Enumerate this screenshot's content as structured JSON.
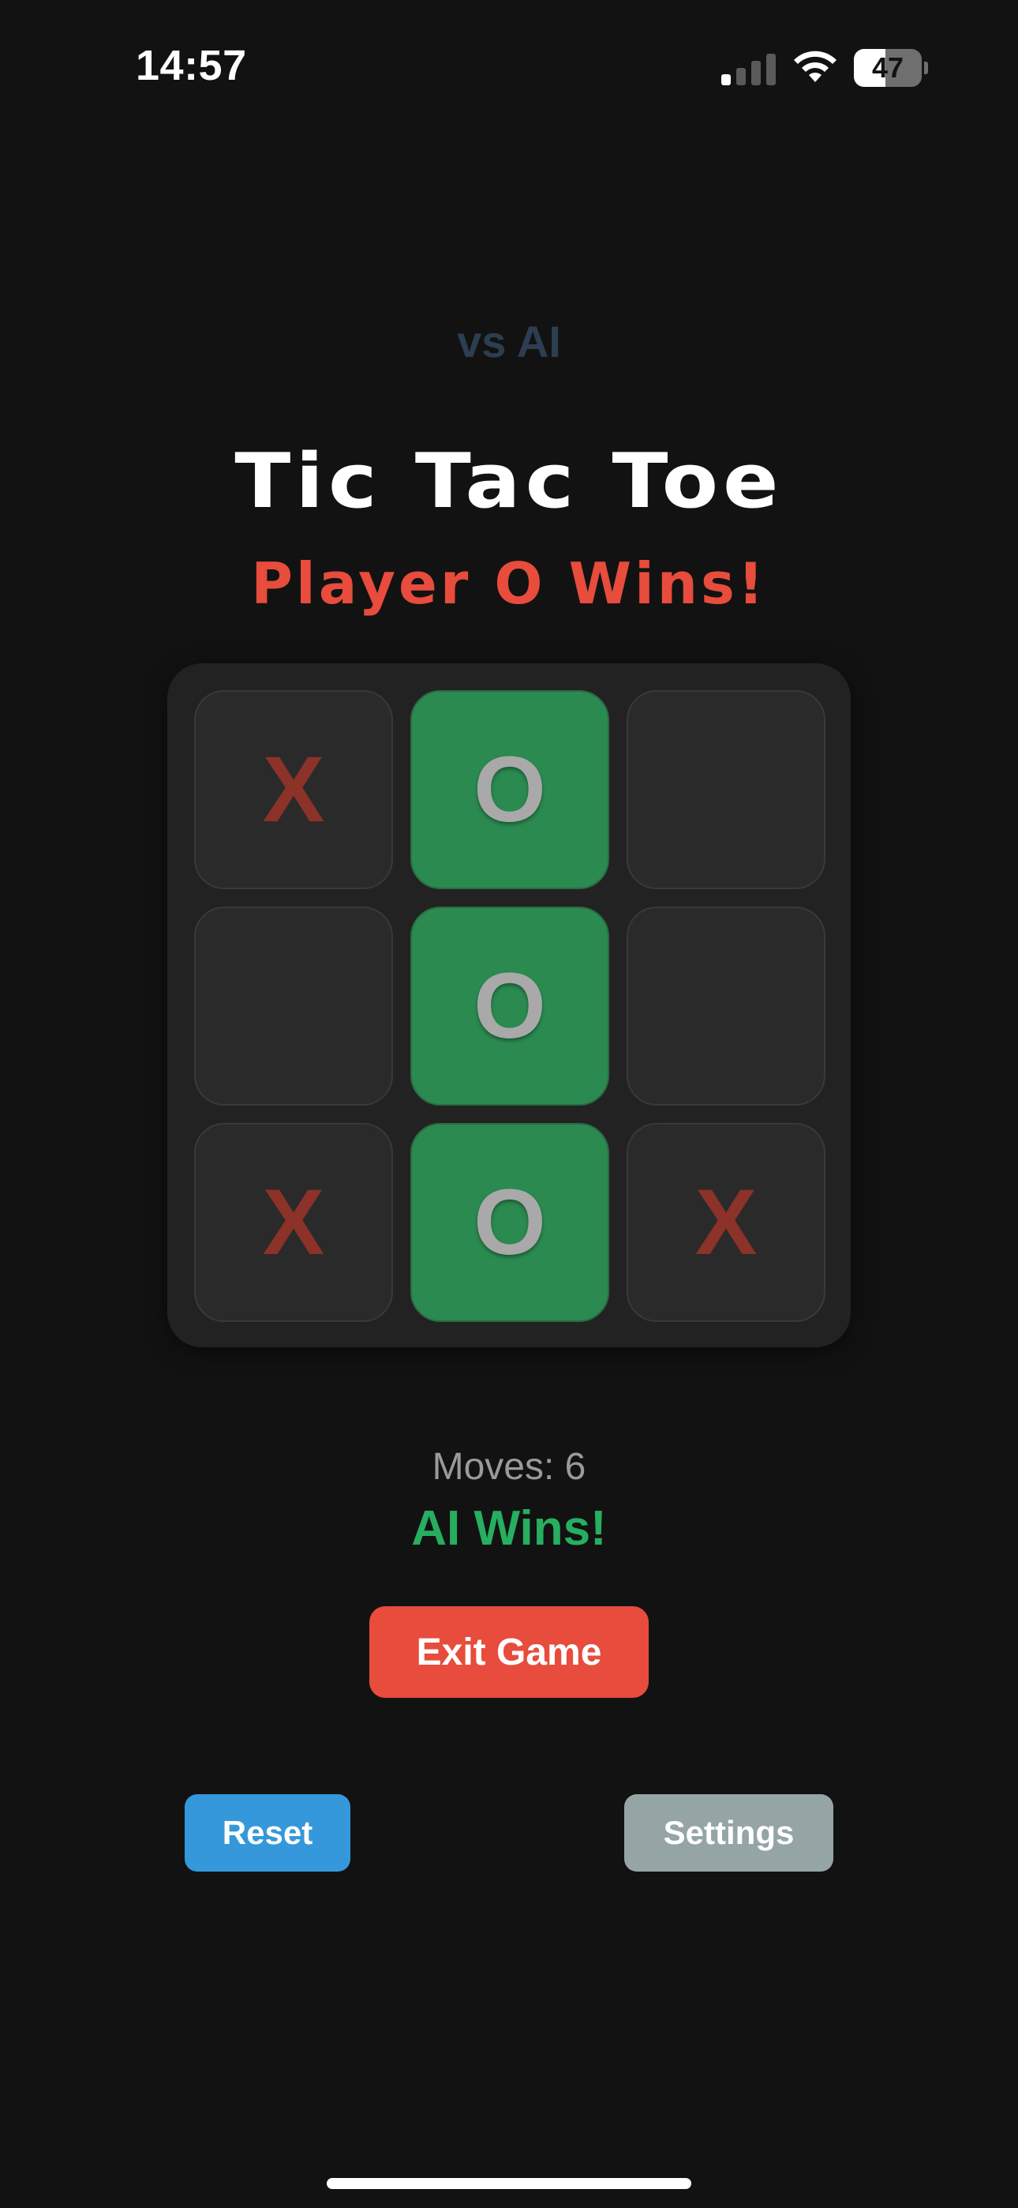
{
  "status_bar": {
    "time": "14:57",
    "battery_level": "47",
    "battery_fraction": 0.47,
    "signal_bars_active": 1,
    "signal_bars_total": 4
  },
  "header": {
    "mode": "vs AI",
    "title": "Tic Tac Toe",
    "status": "Player O Wins!"
  },
  "board": {
    "cells": [
      "X",
      "O",
      "",
      "",
      "O",
      "",
      "X",
      "O",
      "X"
    ],
    "winning_cells": [
      1,
      4,
      7
    ]
  },
  "info": {
    "moves": "Moves: 6",
    "result": "AI Wins!"
  },
  "buttons": {
    "exit": "Exit Game",
    "reset": "Reset",
    "settings": "Settings"
  },
  "colors": {
    "background": "#121212",
    "x_mark": "#8c3228",
    "o_mark": "#a9a9a9",
    "win_cell": "#2a8a50",
    "status_red": "#e74c3c",
    "result_green": "#27ae60",
    "reset_blue": "#3498db",
    "settings_gray": "#95a5a6",
    "mode_label": "#2c3e50"
  }
}
